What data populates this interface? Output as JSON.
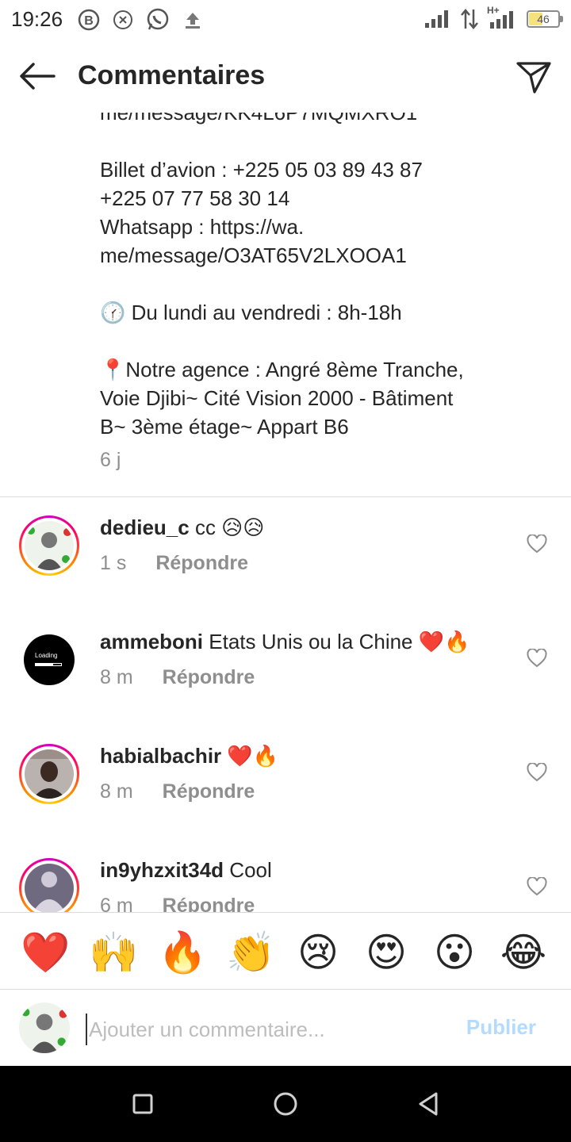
{
  "status_bar": {
    "time": "19:26",
    "network": "H+",
    "battery": "46"
  },
  "header": {
    "title": "Commentaires"
  },
  "post": {
    "caption_lines": [
      "me/message/KK4L6P7MQMXRO1",
      "",
      "Billet d’avion : +225 05 03 89 43 87",
      "+225 07 77 58 30 14",
      "Whatsapp : https://wa.",
      "me/message/O3AT65V2LXOOA1",
      "",
      "🕜 Du lundi au vendredi : 8h-18h",
      "",
      "📍Notre agence : Angré 8ème Tranche,",
      "Voie Djibi~ Cité Vision 2000 - Bâtiment",
      "B~ 3ème étage~ Appart B6"
    ],
    "time": "6 j"
  },
  "comments": [
    {
      "username": "dedieu_c",
      "text": "cc 😥😥",
      "time": "1 s",
      "reply_label": "Répondre",
      "avatar_text": ""
    },
    {
      "username": "ammeboni",
      "text": "Etats Unis ou la Chine ❤️🔥",
      "time": "8 m",
      "reply_label": "Répondre",
      "avatar_text": "Loading"
    },
    {
      "username": "habialbachir",
      "text": "❤️🔥",
      "time": "8 m",
      "reply_label": "Répondre",
      "avatar_text": ""
    },
    {
      "username": "in9yhzxit34d",
      "text": "Cool",
      "time": "6 m",
      "reply_label": "Répondre",
      "avatar_text": ""
    }
  ],
  "emoji_bar": [
    "❤️",
    "🙌",
    "🔥",
    "👏",
    "😢",
    "😍",
    "😮",
    "😂"
  ],
  "composer": {
    "placeholder": "Ajouter un commentaire...",
    "publish_label": "Publier"
  },
  "colors": {
    "text": "#262626",
    "secondary": "#8e8e8e",
    "publish_disabled": "#b3dbff",
    "divider": "#dbdbdb"
  }
}
